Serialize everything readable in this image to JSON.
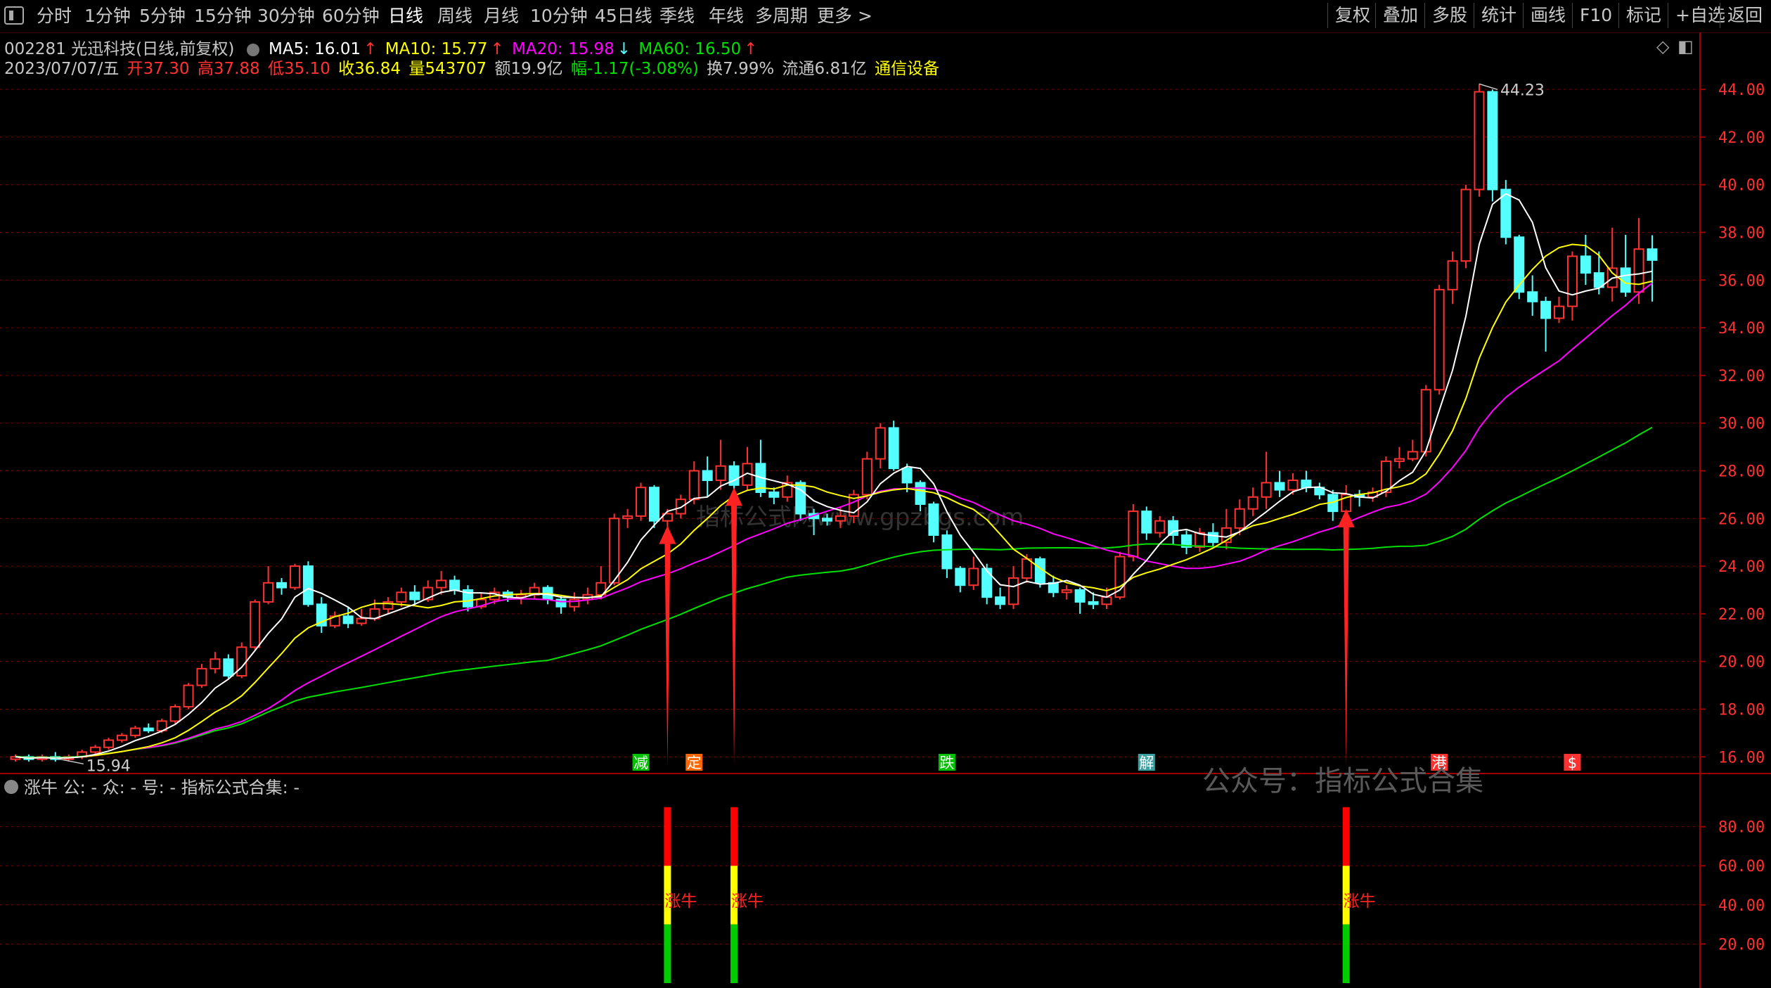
{
  "toolbar": {
    "left_tabs": [
      "分时",
      "1分钟",
      "5分钟",
      "15分钟",
      "30分钟",
      "60分钟",
      "日线",
      "周线",
      "月线",
      "10分钟",
      "45日线",
      "季线",
      "年线",
      "多周期",
      "更多 >"
    ],
    "active_tab": "日线",
    "right_buttons": [
      "复权",
      "叠加",
      "多股",
      "统计",
      "画线",
      "F10",
      "标记",
      "+自选",
      "返回"
    ]
  },
  "header": {
    "stock": "002281 光迅科技(日线,前复权)",
    "ma5_label": "MA5: 16.01",
    "ma10_label": "MA10: 15.77",
    "ma20_label": "MA20: 15.98",
    "ma60_label": "MA60: 16.50",
    "date": "2023/07/07/五",
    "open": "开37.30",
    "high": "高37.88",
    "low": "低35.10",
    "close": "收36.84",
    "volume": "量543707",
    "amount": "额19.9亿",
    "change": "幅-1.17(-3.08%)",
    "turnover": "换7.99%",
    "float": "流通6.81亿",
    "industry": "通信设备"
  },
  "colors": {
    "up": "#ff3232",
    "down": "#54ffff",
    "ma5": "#ffffff",
    "ma10": "#ffff00",
    "ma20": "#ff00ff",
    "ma60": "#00e000",
    "grid": "#7a0000"
  },
  "sub_panel": {
    "title": "涨牛 公: - 众: - 号: - 指标公式合集: -",
    "signal_label": "涨牛",
    "y_ticks": [
      "80.00",
      "60.00",
      "40.00",
      "20.00"
    ]
  },
  "watermark": "公众号：指标公式合集",
  "faint_watermark": "指标公式网www.gpzbgs.com",
  "event_markers": [
    "减",
    "定",
    "跌",
    "解",
    "港",
    "$"
  ],
  "chart_data": {
    "type": "candlestick",
    "y_ticks": [
      "44.00",
      "42.00",
      "40.00",
      "38.00",
      "36.00",
      "34.00",
      "32.00",
      "30.00",
      "28.00",
      "26.00",
      "24.00",
      "22.00",
      "20.00",
      "18.00",
      "16.00"
    ],
    "ylim": [
      15.3,
      44.8
    ],
    "annotations": {
      "high": "44.23",
      "low": "15.94"
    },
    "candles": [
      [
        15.9,
        16.0,
        15.8,
        16.1
      ],
      [
        16.0,
        15.9,
        15.8,
        16.1
      ],
      [
        15.9,
        16.0,
        15.8,
        16.1
      ],
      [
        16.0,
        15.9,
        15.8,
        16.2
      ],
      [
        15.9,
        16.0,
        15.8,
        16.1
      ],
      [
        16.0,
        16.2,
        15.9,
        16.3
      ],
      [
        16.2,
        16.4,
        16.1,
        16.5
      ],
      [
        16.4,
        16.7,
        16.3,
        16.8
      ],
      [
        16.7,
        16.9,
        16.6,
        17.0
      ],
      [
        16.9,
        17.2,
        16.8,
        17.3
      ],
      [
        17.2,
        17.1,
        17.0,
        17.4
      ],
      [
        17.1,
        17.5,
        17.0,
        17.6
      ],
      [
        17.5,
        18.1,
        17.4,
        18.2
      ],
      [
        18.1,
        19.0,
        18.0,
        19.1
      ],
      [
        19.0,
        19.7,
        18.9,
        19.9
      ],
      [
        19.7,
        20.1,
        19.5,
        20.4
      ],
      [
        20.1,
        19.4,
        19.3,
        20.3
      ],
      [
        19.4,
        20.6,
        19.3,
        20.8
      ],
      [
        20.6,
        22.5,
        20.5,
        22.6
      ],
      [
        22.5,
        23.3,
        22.4,
        24.0
      ],
      [
        23.3,
        23.1,
        22.8,
        23.5
      ],
      [
        23.1,
        24.0,
        23.0,
        24.1
      ],
      [
        24.0,
        22.4,
        22.3,
        24.2
      ],
      [
        22.4,
        21.5,
        21.2,
        22.7
      ],
      [
        21.5,
        21.9,
        21.4,
        22.1
      ],
      [
        21.9,
        21.6,
        21.4,
        22.3
      ],
      [
        21.6,
        21.8,
        21.5,
        22.2
      ],
      [
        21.8,
        22.2,
        21.7,
        22.6
      ],
      [
        22.2,
        22.5,
        22.0,
        22.7
      ],
      [
        22.5,
        22.9,
        22.3,
        23.1
      ],
      [
        22.9,
        22.6,
        22.4,
        23.2
      ],
      [
        22.6,
        23.1,
        22.5,
        23.4
      ],
      [
        23.1,
        23.4,
        22.8,
        23.8
      ],
      [
        23.4,
        23.0,
        22.8,
        23.6
      ],
      [
        23.0,
        22.3,
        22.1,
        23.2
      ],
      [
        22.3,
        22.6,
        22.2,
        22.9
      ],
      [
        22.6,
        22.9,
        22.4,
        23.1
      ],
      [
        22.9,
        22.7,
        22.5,
        23.0
      ],
      [
        22.7,
        22.8,
        22.4,
        23.0
      ],
      [
        22.8,
        23.1,
        22.6,
        23.3
      ],
      [
        23.1,
        22.6,
        22.4,
        23.2
      ],
      [
        22.6,
        22.3,
        22.0,
        22.8
      ],
      [
        22.3,
        22.6,
        22.1,
        22.9
      ],
      [
        22.6,
        22.8,
        22.4,
        23.1
      ],
      [
        22.8,
        23.3,
        22.6,
        24.0
      ],
      [
        23.3,
        26.0,
        23.2,
        26.2
      ],
      [
        26.0,
        26.1,
        25.6,
        26.4
      ],
      [
        26.1,
        27.3,
        25.9,
        27.5
      ],
      [
        27.3,
        25.9,
        25.6,
        27.4
      ],
      [
        25.9,
        26.2,
        25.4,
        26.4
      ],
      [
        26.2,
        26.8,
        26.0,
        27.0
      ],
      [
        26.8,
        28.0,
        26.6,
        28.4
      ],
      [
        28.0,
        27.6,
        26.9,
        28.6
      ],
      [
        27.6,
        28.2,
        27.2,
        29.3
      ],
      [
        28.2,
        27.4,
        27.0,
        28.4
      ],
      [
        27.4,
        28.3,
        27.2,
        29.0
      ],
      [
        28.3,
        27.1,
        26.9,
        29.3
      ],
      [
        27.1,
        26.9,
        26.6,
        27.3
      ],
      [
        26.9,
        27.5,
        26.7,
        27.8
      ],
      [
        27.5,
        26.2,
        25.9,
        27.6
      ],
      [
        26.2,
        26.0,
        25.3,
        26.4
      ],
      [
        26.0,
        25.9,
        25.7,
        26.2
      ],
      [
        25.9,
        26.1,
        25.6,
        26.5
      ],
      [
        26.1,
        27.0,
        25.8,
        27.2
      ],
      [
        27.0,
        28.5,
        26.8,
        28.8
      ],
      [
        28.5,
        29.8,
        28.1,
        30.0
      ],
      [
        29.8,
        28.1,
        28.0,
        30.1
      ],
      [
        28.1,
        27.5,
        27.1,
        28.3
      ],
      [
        27.5,
        26.6,
        26.3,
        27.6
      ],
      [
        26.6,
        25.3,
        25.0,
        26.7
      ],
      [
        25.3,
        23.9,
        23.5,
        25.5
      ],
      [
        23.9,
        23.2,
        22.9,
        24.0
      ],
      [
        23.2,
        23.9,
        23.0,
        24.4
      ],
      [
        23.9,
        22.7,
        22.4,
        24.1
      ],
      [
        22.7,
        22.4,
        22.2,
        23.1
      ],
      [
        22.4,
        23.5,
        22.2,
        24.0
      ],
      [
        23.5,
        24.3,
        23.3,
        24.5
      ],
      [
        24.3,
        23.3,
        23.1,
        24.4
      ],
      [
        23.3,
        22.9,
        22.7,
        23.6
      ],
      [
        22.9,
        23.0,
        22.6,
        23.2
      ],
      [
        23.0,
        22.5,
        22.0,
        23.1
      ],
      [
        22.5,
        22.4,
        22.2,
        22.9
      ],
      [
        22.4,
        22.7,
        22.2,
        23.1
      ],
      [
        22.7,
        24.4,
        22.6,
        24.6
      ],
      [
        24.4,
        26.3,
        24.2,
        26.6
      ],
      [
        26.3,
        25.4,
        25.1,
        26.5
      ],
      [
        25.4,
        25.9,
        25.2,
        26.1
      ],
      [
        25.9,
        25.3,
        24.9,
        26.1
      ],
      [
        25.3,
        24.8,
        24.5,
        25.5
      ],
      [
        24.8,
        25.4,
        24.6,
        25.6
      ],
      [
        25.4,
        25.0,
        24.8,
        25.8
      ],
      [
        25.0,
        25.6,
        24.7,
        26.4
      ],
      [
        25.6,
        26.4,
        25.3,
        26.8
      ],
      [
        26.4,
        26.9,
        26.1,
        27.3
      ],
      [
        26.9,
        27.5,
        26.4,
        28.8
      ],
      [
        27.5,
        27.2,
        26.9,
        28.0
      ],
      [
        27.2,
        27.6,
        27.0,
        27.9
      ],
      [
        27.6,
        27.3,
        27.1,
        28.0
      ],
      [
        27.3,
        27.0,
        26.8,
        27.5
      ],
      [
        27.0,
        26.3,
        25.9,
        27.2
      ],
      [
        26.3,
        27.0,
        26.1,
        27.4
      ],
      [
        27.0,
        26.9,
        26.5,
        27.2
      ],
      [
        26.9,
        27.1,
        26.7,
        27.3
      ],
      [
        27.1,
        28.4,
        26.9,
        28.6
      ],
      [
        28.4,
        28.5,
        28.1,
        29.0
      ],
      [
        28.5,
        28.8,
        28.4,
        29.3
      ],
      [
        28.8,
        31.4,
        28.6,
        31.6
      ],
      [
        31.4,
        35.6,
        31.2,
        35.8
      ],
      [
        35.6,
        36.8,
        35.0,
        37.2
      ],
      [
        36.8,
        39.8,
        36.5,
        40.0
      ],
      [
        39.8,
        43.9,
        39.5,
        44.23
      ],
      [
        43.9,
        39.8,
        39.3,
        44.0
      ],
      [
        39.8,
        37.8,
        37.5,
        40.2
      ],
      [
        37.8,
        35.5,
        35.2,
        37.9
      ],
      [
        35.5,
        35.1,
        34.5,
        36.2
      ],
      [
        35.1,
        34.4,
        33.0,
        35.3
      ],
      [
        34.4,
        34.9,
        34.2,
        35.3
      ],
      [
        34.9,
        37.0,
        34.3,
        37.2
      ],
      [
        37.0,
        36.3,
        35.8,
        37.9
      ],
      [
        36.3,
        35.7,
        35.4,
        37.2
      ],
      [
        35.7,
        36.5,
        35.1,
        38.2
      ],
      [
        36.5,
        35.5,
        35.3,
        37.9
      ],
      [
        35.5,
        37.3,
        35.0,
        38.6
      ],
      [
        37.3,
        36.84,
        35.1,
        37.88
      ]
    ],
    "signals": [
      [
        47,
        "定"
      ],
      [
        49,
        "定"
      ],
      [
        107,
        "港"
      ]
    ],
    "signal_values": [
      90,
      60,
      30
    ]
  }
}
